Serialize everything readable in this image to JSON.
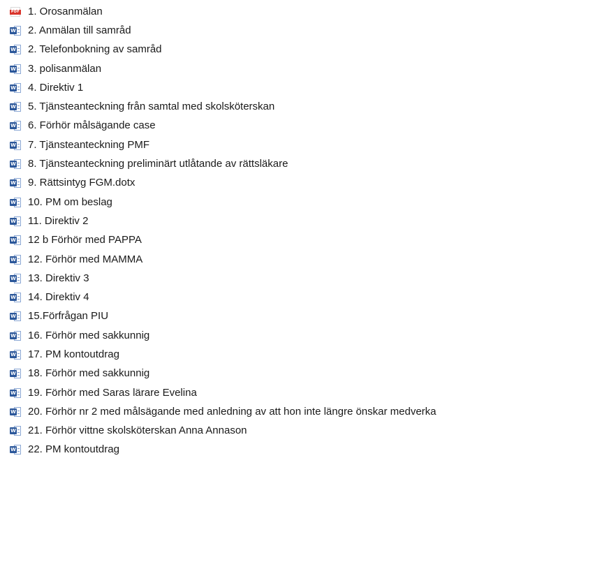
{
  "files": [
    {
      "name": "1. Orosanmälan",
      "icon": "pdf-file-icon"
    },
    {
      "name": "2. Anmälan till samråd",
      "icon": "word-document-icon"
    },
    {
      "name": "2. Telefonbokning av samråd",
      "icon": "word-document-icon"
    },
    {
      "name": "3. polisanmälan",
      "icon": "word-document-icon"
    },
    {
      "name": "4. Direktiv 1",
      "icon": "word-document-icon"
    },
    {
      "name": "5. Tjänsteanteckning från samtal med skolsköterskan",
      "icon": "word-document-icon"
    },
    {
      "name": "6. Förhör målsägande case",
      "icon": "word-document-icon"
    },
    {
      "name": "7. Tjänsteanteckning PMF",
      "icon": "word-document-icon"
    },
    {
      "name": "8. Tjänsteanteckning preliminärt utlåtande av rättsläkare",
      "icon": "word-document-icon"
    },
    {
      "name": "9. Rättsintyg FGM.dotx",
      "icon": "word-document-icon"
    },
    {
      "name": "10. PM om beslag",
      "icon": "word-document-icon"
    },
    {
      "name": "11. Direktiv 2",
      "icon": "word-document-icon"
    },
    {
      "name": "12 b Förhör med PAPPA",
      "icon": "word-document-icon"
    },
    {
      "name": "12. Förhör med MAMMA",
      "icon": "word-document-icon"
    },
    {
      "name": "13. Direktiv 3",
      "icon": "word-document-icon"
    },
    {
      "name": "14. Direktiv 4",
      "icon": "word-document-icon"
    },
    {
      "name": "15.Förfrågan PIU",
      "icon": "word-document-icon"
    },
    {
      "name": "16. Förhör med sakkunnig",
      "icon": "word-document-icon"
    },
    {
      "name": "17. PM kontoutdrag",
      "icon": "word-document-icon"
    },
    {
      "name": "18. Förhör med sakkunnig",
      "icon": "word-document-icon"
    },
    {
      "name": "19. Förhör med Saras lärare Evelina",
      "icon": "word-document-icon"
    },
    {
      "name": "20. Förhör nr 2 med målsägande med anledning av att hon inte längre önskar medverka",
      "icon": "word-document-icon"
    },
    {
      "name": "21. Förhör vittne skolsköterskan Anna Annason",
      "icon": "word-document-icon"
    },
    {
      "name": "22. PM kontoutdrag",
      "icon": "word-document-icon"
    }
  ],
  "icon_labels": {
    "pdf": "PDF",
    "word": "W"
  },
  "colors": {
    "word_badge": "#2b579a",
    "pdf_band": "#d9342b",
    "text": "#1a1a1a",
    "background": "#ffffff"
  }
}
